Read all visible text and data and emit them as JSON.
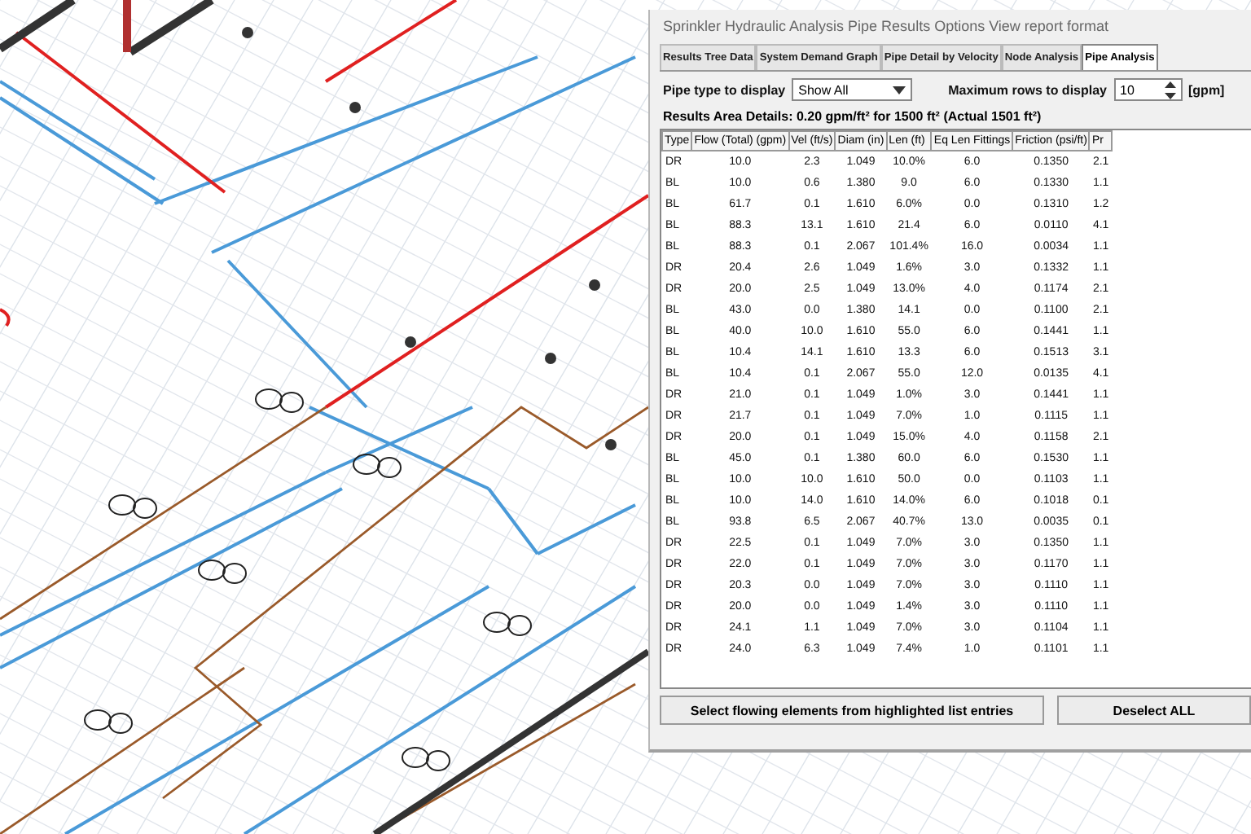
{
  "window": {
    "title": "Sprinkler Hydraulic Analysis  Pipe Results  Options  View report format"
  },
  "tabs": [
    {
      "label": "Results Tree Data",
      "selected": false
    },
    {
      "label": "System Demand Graph",
      "selected": false
    },
    {
      "label": "Pipe Detail by Velocity",
      "selected": false
    },
    {
      "label": "Node Analysis",
      "selected": false
    },
    {
      "label": "Pipe Analysis",
      "selected": true
    }
  ],
  "filter": {
    "pipe_type_label": "Pipe type to display",
    "pipe_type_value": "Show All",
    "max_rows_label": "Maximum rows to display",
    "max_rows_value": "10",
    "unit": "[gpm]"
  },
  "details": "Results Area Details: 0.20 gpm/ft² for 1500 ft² (Actual 1501 ft²)",
  "table": {
    "columns": [
      "Type",
      "Flow (Total) (gpm)",
      "Vel (ft/s)",
      "Diam (in)",
      "Len (ft)",
      "Eq Len Fittings",
      "Friction (psi/ft)",
      "Pr"
    ],
    "rows": [
      [
        "DR",
        "10.0",
        "2.3",
        "1.049",
        "10.0%",
        "6.0",
        "0.1350",
        "2.1"
      ],
      [
        "BL",
        "10.0",
        "0.6",
        "1.380",
        "9.0",
        "6.0",
        "0.1330",
        "1.1"
      ],
      [
        "BL",
        "61.7",
        "0.1",
        "1.610",
        "6.0%",
        "0.0",
        "0.1310",
        "1.2"
      ],
      [
        "BL",
        "88.3",
        "13.1",
        "1.610",
        "21.4",
        "6.0",
        "0.0110",
        "4.1"
      ],
      [
        "BL",
        "88.3",
        "0.1",
        "2.067",
        "101.4%",
        "16.0",
        "0.0034",
        "1.1"
      ],
      [
        "DR",
        "20.4",
        "2.6",
        "1.049",
        "1.6%",
        "3.0",
        "0.1332",
        "1.1"
      ],
      [
        "DR",
        "20.0",
        "2.5",
        "1.049",
        "13.0%",
        "4.0",
        "0.1174",
        "2.1"
      ],
      [
        "BL",
        "43.0",
        "0.0",
        "1.380",
        "14.1",
        "0.0",
        "0.1100",
        "2.1"
      ],
      [
        "BL",
        "40.0",
        "10.0",
        "1.610",
        "55.0",
        "6.0",
        "0.1441",
        "1.1"
      ],
      [
        "BL",
        "10.4",
        "14.1",
        "1.610",
        "13.3",
        "6.0",
        "0.1513",
        "3.1"
      ],
      [
        "BL",
        "10.4",
        "0.1",
        "2.067",
        "55.0",
        "12.0",
        "0.0135",
        "4.1"
      ],
      [
        "DR",
        "21.0",
        "0.1",
        "1.049",
        "1.0%",
        "3.0",
        "0.1441",
        "1.1"
      ],
      [
        "DR",
        "21.7",
        "0.1",
        "1.049",
        "7.0%",
        "1.0",
        "0.1115",
        "1.1"
      ],
      [
        "DR",
        "20.0",
        "0.1",
        "1.049",
        "15.0%",
        "4.0",
        "0.1158",
        "2.1"
      ],
      [
        "BL",
        "45.0",
        "0.1",
        "1.380",
        "60.0",
        "6.0",
        "0.1530",
        "1.1"
      ],
      [
        "BL",
        "10.0",
        "10.0",
        "1.610",
        "50.0",
        "0.0",
        "0.1103",
        "1.1"
      ],
      [
        "BL",
        "10.0",
        "14.0",
        "1.610",
        "14.0%",
        "6.0",
        "0.1018",
        "0.1"
      ],
      [
        "BL",
        "93.8",
        "6.5",
        "2.067",
        "40.7%",
        "13.0",
        "0.0035",
        "0.1"
      ],
      [
        "DR",
        "22.5",
        "0.1",
        "1.049",
        "7.0%",
        "3.0",
        "0.1350",
        "1.1"
      ],
      [
        "DR",
        "22.0",
        "0.1",
        "1.049",
        "7.0%",
        "3.0",
        "0.1170",
        "1.1"
      ],
      [
        "DR",
        "20.3",
        "0.0",
        "1.049",
        "7.0%",
        "3.0",
        "0.1110",
        "1.1"
      ],
      [
        "DR",
        "20.0",
        "0.0",
        "1.049",
        "1.4%",
        "3.0",
        "0.1110",
        "1.1"
      ],
      [
        "DR",
        "24.1",
        "1.1",
        "1.049",
        "7.0%",
        "3.0",
        "0.1104",
        "1.1"
      ],
      [
        "DR",
        "24.0",
        "6.3",
        "1.049",
        "7.4%",
        "1.0",
        "0.1101",
        "1.1"
      ]
    ]
  },
  "buttons": [
    "Select flowing elements from highlighted list entries",
    "Deselect ALL"
  ]
}
